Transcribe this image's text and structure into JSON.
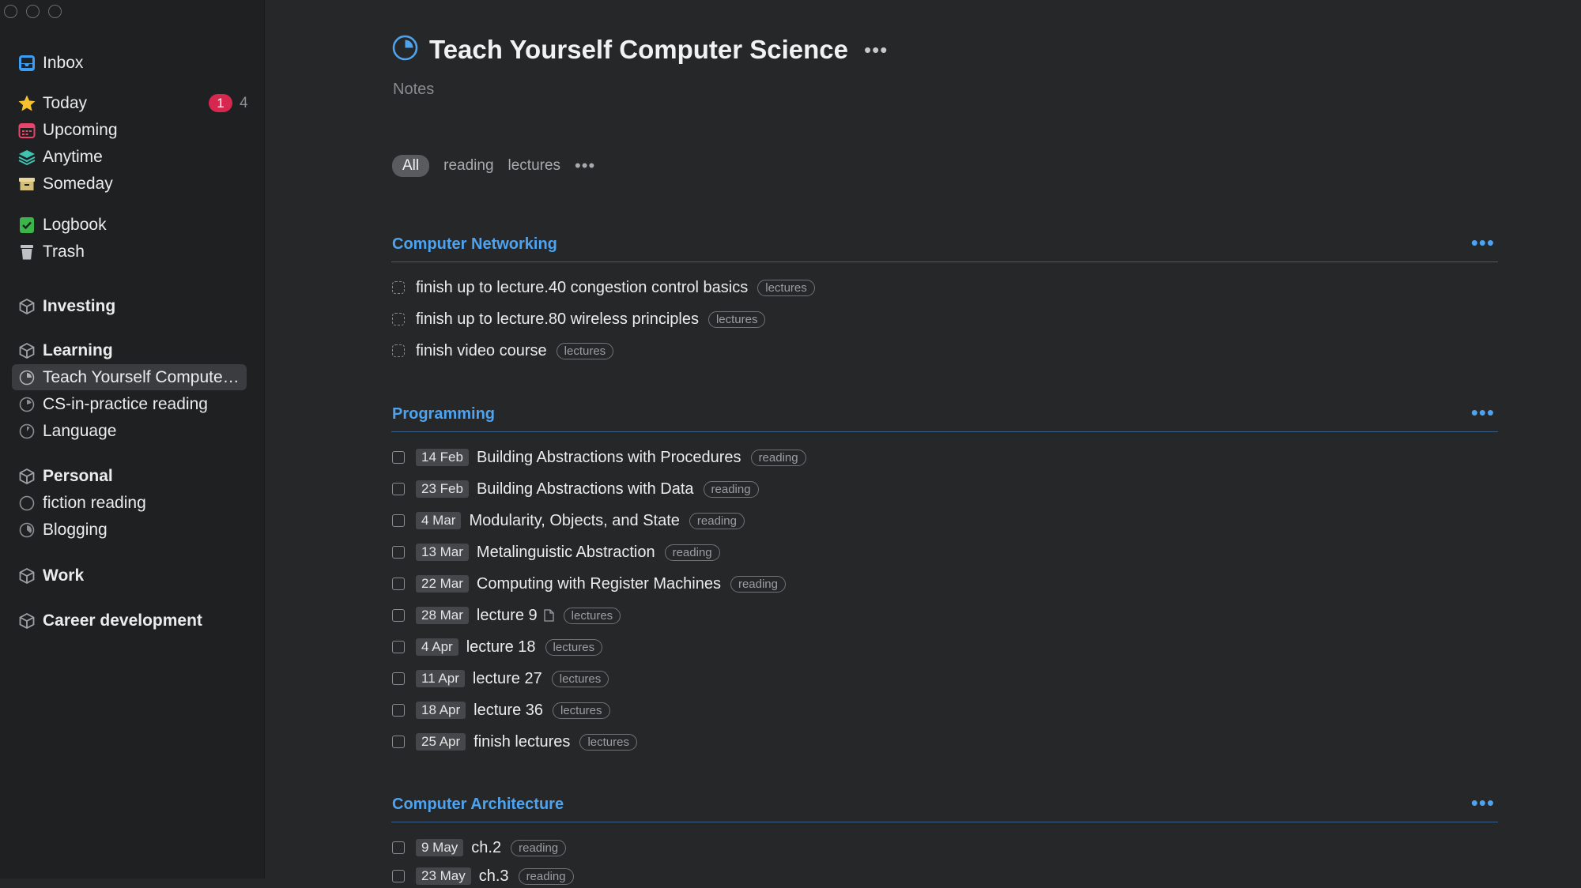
{
  "sidebar": {
    "inbox": {
      "label": "Inbox",
      "icon": "inbox-tray-icon"
    },
    "today": {
      "label": "Today",
      "icon": "star-icon",
      "badge": "1",
      "count": "4"
    },
    "upcoming": {
      "label": "Upcoming",
      "icon": "calendar-icon"
    },
    "anytime": {
      "label": "Anytime",
      "icon": "layers-icon"
    },
    "someday": {
      "label": "Someday",
      "icon": "archive-box-icon"
    },
    "logbook": {
      "label": "Logbook",
      "icon": "logbook-check-icon"
    },
    "trash": {
      "label": "Trash",
      "icon": "trash-icon"
    },
    "areas": [
      {
        "label": "Investing",
        "icon": "area-cube-icon",
        "projects": []
      },
      {
        "label": "Learning",
        "icon": "area-cube-icon",
        "projects": [
          {
            "label": "Teach Yourself Computer Science",
            "display": "Teach Yourself Computer...",
            "progress": 0.25,
            "selected": true
          },
          {
            "label": "CS-in-practice reading",
            "progress": 0.2
          },
          {
            "label": "Language",
            "progress": 0.1
          }
        ]
      },
      {
        "label": "Personal",
        "icon": "area-cube-icon",
        "projects": [
          {
            "label": "fiction reading",
            "progress": 0.0
          },
          {
            "label": "Blogging",
            "progress": 0.35
          }
        ]
      },
      {
        "label": "Work",
        "icon": "area-cube-icon",
        "projects": []
      },
      {
        "label": "Career development",
        "icon": "area-cube-icon",
        "projects": []
      }
    ]
  },
  "project": {
    "title": "Teach Yourself Computer Science",
    "progress": 0.25,
    "more": "•••",
    "notes_placeholder": "Notes",
    "filters": [
      "All",
      "reading",
      "lectures"
    ],
    "filters_more": "•••"
  },
  "sections": [
    {
      "name": "Computer Networking",
      "more": "•••",
      "tasks": [
        {
          "title": "finish up to lecture.40 congestion control basics",
          "tag": "lectures",
          "someday": true
        },
        {
          "title": "finish up to lecture.80 wireless principles",
          "tag": "lectures",
          "someday": true
        },
        {
          "title": "finish video course",
          "tag": "lectures",
          "someday": true
        }
      ]
    },
    {
      "name": "Programming",
      "more": "•••",
      "tasks": [
        {
          "date": "14 Feb",
          "title": "Building Abstractions with Procedures",
          "tag": "reading"
        },
        {
          "date": "23 Feb",
          "title": "Building Abstractions with Data",
          "tag": "reading"
        },
        {
          "date": "4 Mar",
          "title": "Modularity, Objects, and State",
          "tag": "reading"
        },
        {
          "date": "13 Mar",
          "title": "Metalinguistic Abstraction",
          "tag": "reading"
        },
        {
          "date": "22 Mar",
          "title": "Computing with Register Machines",
          "tag": "reading"
        },
        {
          "date": "28 Mar",
          "title": "lecture 9",
          "tag": "lectures",
          "has_note": true
        },
        {
          "date": "4 Apr",
          "title": "lecture 18",
          "tag": "lectures"
        },
        {
          "date": "11 Apr",
          "title": "lecture 27",
          "tag": "lectures"
        },
        {
          "date": "18 Apr",
          "title": "lecture 36",
          "tag": "lectures"
        },
        {
          "date": "25 Apr",
          "title": "finish lectures",
          "tag": "lectures"
        }
      ]
    },
    {
      "name": "Computer Architecture",
      "more": "•••",
      "tasks": [
        {
          "date": "9 May",
          "title": "ch.2",
          "tag": "reading"
        },
        {
          "date": "23 May",
          "title": "ch.3",
          "tag": "reading"
        }
      ]
    }
  ],
  "colors": {
    "accent": "#4ea3f0",
    "badge": "#d6284e",
    "sidebar_bg": "#1f2022",
    "main_bg": "#262729"
  }
}
